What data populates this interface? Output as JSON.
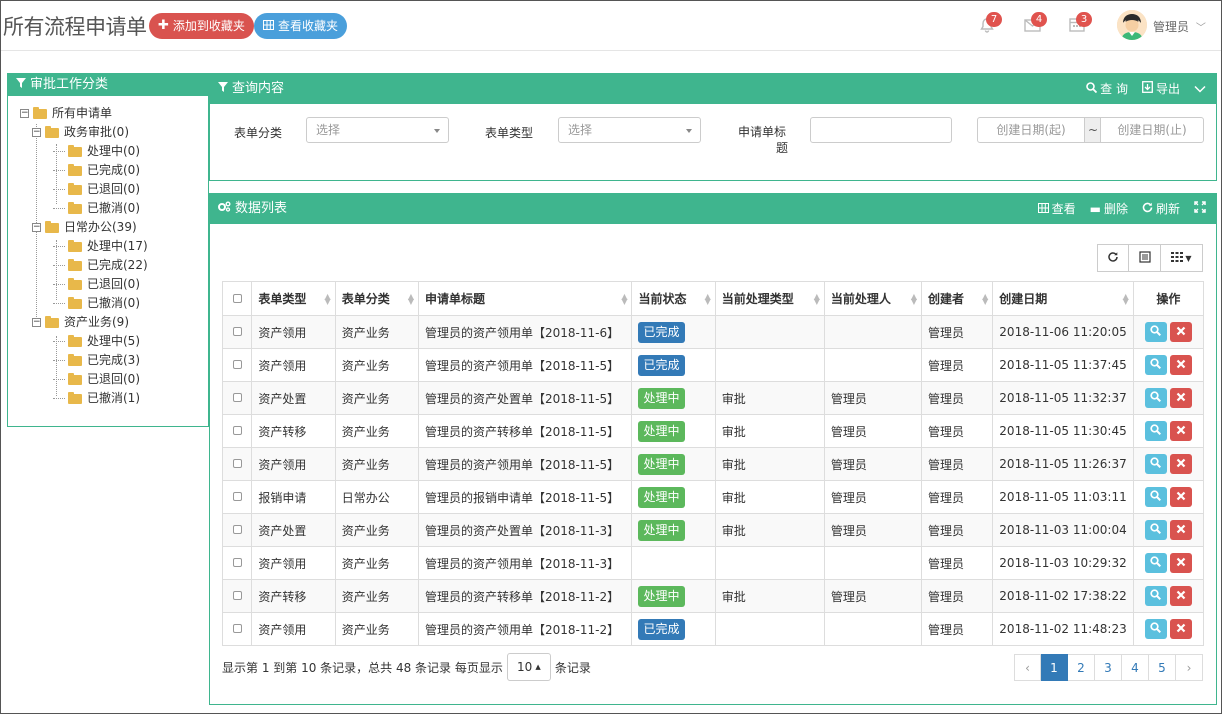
{
  "header": {
    "title": "所有流程申请单",
    "add_fav_label": "添加到收藏夹",
    "view_fav_label": "查看收藏夹",
    "notify_count": "7",
    "mail_count": "4",
    "calendar_count": "3",
    "user_name": "管理员"
  },
  "category_panel": {
    "title": "审批工作分类",
    "root": "所有申请单",
    "groups": [
      {
        "label": "政务审批(0)",
        "children": [
          "处理中(0)",
          "已完成(0)",
          "已退回(0)",
          "已撤消(0)"
        ]
      },
      {
        "label": "日常办公(39)",
        "children": [
          "处理中(17)",
          "已完成(22)",
          "已退回(0)",
          "已撤消(0)"
        ]
      },
      {
        "label": "资产业务(9)",
        "children": [
          "处理中(5)",
          "已完成(3)",
          "已退回(0)",
          "已撤消(1)"
        ]
      }
    ]
  },
  "query_panel": {
    "title": "查询内容",
    "search_label": "查 询",
    "export_label": "导出",
    "form_category_label": "表单分类",
    "form_category_value": "选择",
    "form_type_label": "表单类型",
    "form_type_value": "选择",
    "title_label_1": "申请单标",
    "title_label_2": "题",
    "date_start_placeholder": "创建日期(起)",
    "date_sep": "~",
    "date_end_placeholder": "创建日期(止)"
  },
  "data_panel": {
    "title": "数据列表",
    "view_label": "查看",
    "delete_label": "删除",
    "refresh_label": "刷新",
    "columns": [
      "表单类型",
      "表单分类",
      "申请单标题",
      "当前状态",
      "当前处理类型",
      "当前处理人",
      "创建者",
      "创建日期",
      "操作"
    ],
    "rows": [
      {
        "type": "资产领用",
        "category": "资产业务",
        "title": "管理员的资产领用单【2018-11-6】",
        "status": "已完成",
        "status_kind": "done",
        "proc_type": "",
        "handler": "",
        "creator": "管理员",
        "date": "2018-11-06 11:20:05"
      },
      {
        "type": "资产领用",
        "category": "资产业务",
        "title": "管理员的资产领用单【2018-11-5】",
        "status": "已完成",
        "status_kind": "done",
        "proc_type": "",
        "handler": "",
        "creator": "管理员",
        "date": "2018-11-05 11:37:45"
      },
      {
        "type": "资产处置",
        "category": "资产业务",
        "title": "管理员的资产处置单【2018-11-5】",
        "status": "处理中",
        "status_kind": "proc",
        "proc_type": "审批",
        "handler": "管理员",
        "creator": "管理员",
        "date": "2018-11-05 11:32:37"
      },
      {
        "type": "资产转移",
        "category": "资产业务",
        "title": "管理员的资产转移单【2018-11-5】",
        "status": "处理中",
        "status_kind": "proc",
        "proc_type": "审批",
        "handler": "管理员",
        "creator": "管理员",
        "date": "2018-11-05 11:30:45"
      },
      {
        "type": "资产领用",
        "category": "资产业务",
        "title": "管理员的资产领用单【2018-11-5】",
        "status": "处理中",
        "status_kind": "proc",
        "proc_type": "审批",
        "handler": "管理员",
        "creator": "管理员",
        "date": "2018-11-05 11:26:37"
      },
      {
        "type": "报销申请",
        "category": "日常办公",
        "title": "管理员的报销申请单【2018-11-5】",
        "status": "处理中",
        "status_kind": "proc",
        "proc_type": "审批",
        "handler": "管理员",
        "creator": "管理员",
        "date": "2018-11-05 11:03:11"
      },
      {
        "type": "资产处置",
        "category": "资产业务",
        "title": "管理员的资产处置单【2018-11-3】",
        "status": "处理中",
        "status_kind": "proc",
        "proc_type": "审批",
        "handler": "管理员",
        "creator": "管理员",
        "date": "2018-11-03 11:00:04"
      },
      {
        "type": "资产领用",
        "category": "资产业务",
        "title": "管理员的资产领用单【2018-11-3】",
        "status": "",
        "status_kind": "",
        "proc_type": "",
        "handler": "",
        "creator": "管理员",
        "date": "2018-11-03 10:29:32"
      },
      {
        "type": "资产转移",
        "category": "资产业务",
        "title": "管理员的资产转移单【2018-11-2】",
        "status": "处理中",
        "status_kind": "proc",
        "proc_type": "审批",
        "handler": "管理员",
        "creator": "管理员",
        "date": "2018-11-02 17:38:22"
      },
      {
        "type": "资产领用",
        "category": "资产业务",
        "title": "管理员的资产领用单【2018-11-2】",
        "status": "已完成",
        "status_kind": "done",
        "proc_type": "",
        "handler": "",
        "creator": "管理员",
        "date": "2018-11-02 11:48:23"
      }
    ],
    "pager_text_before": "显示第 1 到第 10 条记录，总共 48 条记录 每页显示",
    "page_size": "10",
    "pager_text_after": "条记录",
    "prev": "‹",
    "next": "›",
    "pages": [
      "1",
      "2",
      "3",
      "4",
      "5"
    ],
    "current_page": "1"
  },
  "colors": {
    "accent": "#3fb58e",
    "danger": "#d9534f",
    "info": "#5bc0de",
    "primary": "#337ab7",
    "success": "#5cb85c"
  }
}
